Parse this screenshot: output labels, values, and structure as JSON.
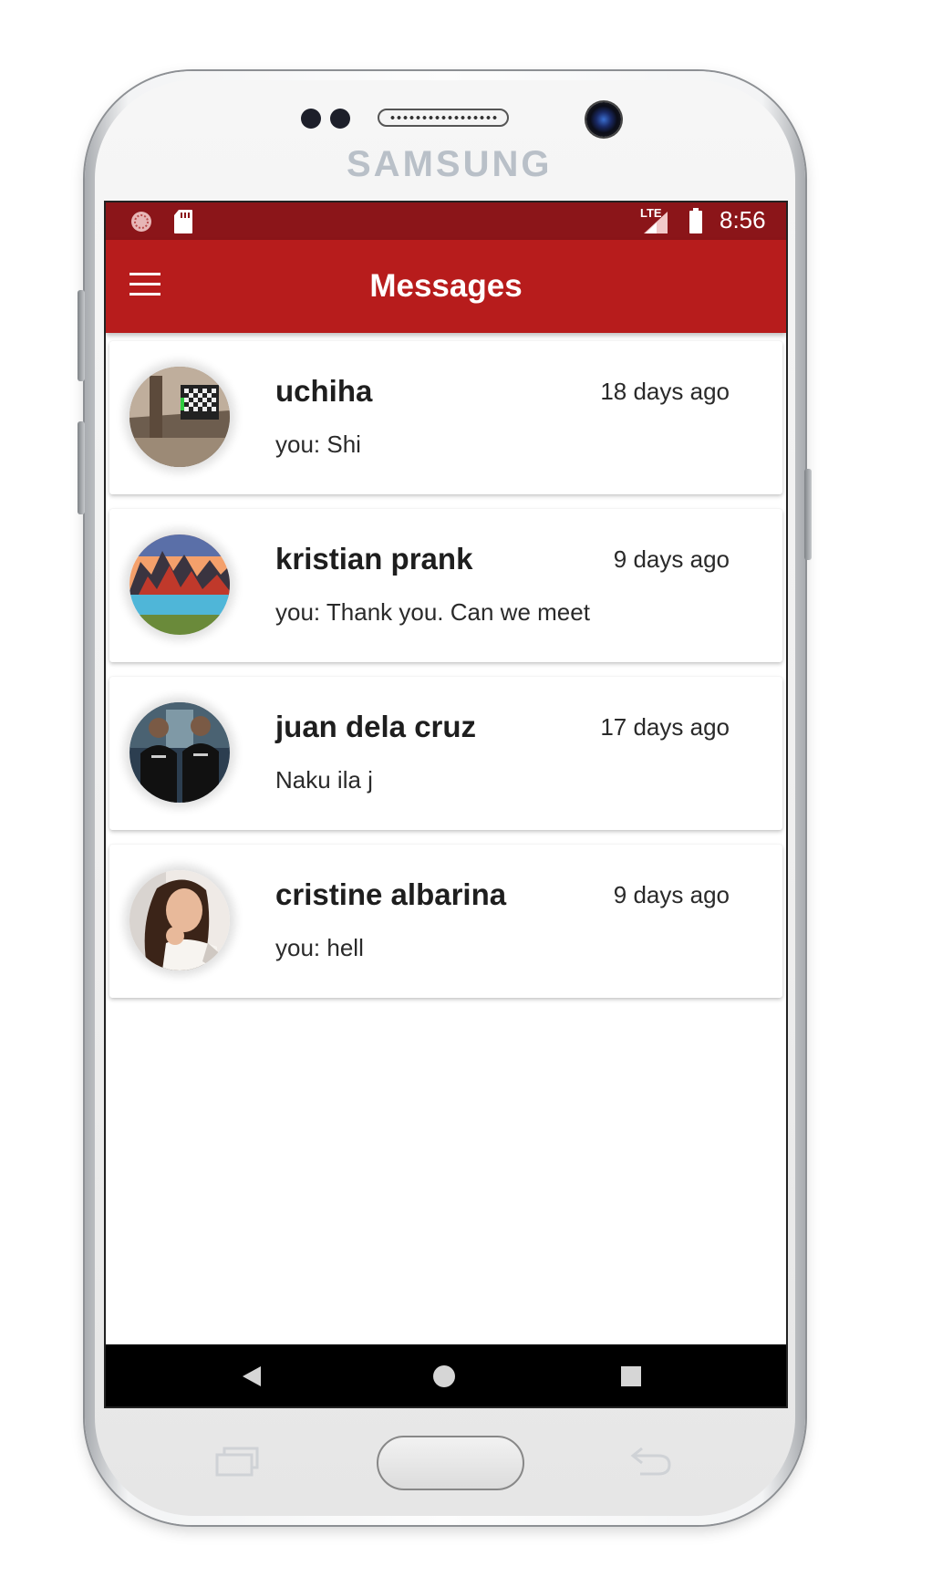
{
  "device": {
    "brand": "SAMSUNG"
  },
  "status_bar": {
    "time": "8:56",
    "network": "LTE",
    "icons": [
      "notification-icon",
      "sd-card-icon",
      "signal-icon",
      "battery-icon"
    ]
  },
  "app_bar": {
    "title": "Messages",
    "menu_icon": "hamburger-menu-icon",
    "color": "#b71c1c",
    "status_color": "#8b1519"
  },
  "conversations": [
    {
      "name": "uchiha",
      "time": "18 days ago",
      "preview": "you: Shi",
      "avatar": "room-photo"
    },
    {
      "name": "kristian prank",
      "time": "9 days ago",
      "preview": "you: Thank you. Can we meet",
      "avatar": "mountain-lake-photo"
    },
    {
      "name": "juan dela cruz",
      "time": "17 days ago",
      "preview": "Naku ila j",
      "avatar": "two-people-photo"
    },
    {
      "name": "cristine albarina",
      "time": "9 days ago",
      "preview": "you: hell",
      "avatar": "selfie-photo"
    }
  ],
  "nav_bar": {
    "buttons": [
      "back-icon",
      "home-icon",
      "recents-icon"
    ]
  },
  "hardware_keys": [
    "recent-apps-key",
    "home-key",
    "back-key"
  ]
}
